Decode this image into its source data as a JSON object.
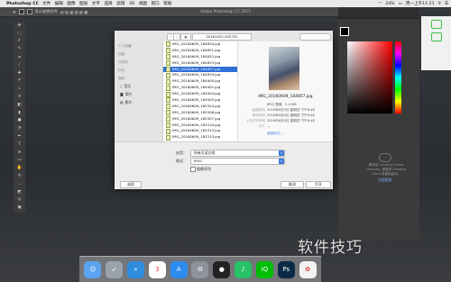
{
  "menubar": {
    "app_name": "Photoshop CC",
    "items": [
      "文件",
      "编辑",
      "图像",
      "图层",
      "文字",
      "选择",
      "滤镜",
      "3D",
      "视图",
      "窗口",
      "帮助"
    ],
    "battery": "24%",
    "clock": "周一上午11:21"
  },
  "options_bar": {
    "checkbox_label": "显示变换控件",
    "window_title": "Adobe Photoshop CC 2015"
  },
  "dialog": {
    "folder": "20161003-005702",
    "sidebar": {
      "sections": [
        {
          "header": "个人收藏",
          "items": []
        },
        {
          "header": "设备",
          "items": []
        },
        {
          "header": "共享的",
          "items": []
        },
        {
          "header": "标记",
          "items": []
        },
        {
          "header": "媒体",
          "items": [
            {
              "label": "音乐",
              "icon": "music-note-icon"
            },
            {
              "label": "照片",
              "icon": "camera-icon"
            },
            {
              "label": "影片",
              "icon": "film-icon"
            }
          ]
        }
      ]
    },
    "files": [
      {
        "name": "IMG_20160609_184850.jpg",
        "selected": false
      },
      {
        "name": "IMG_20160609_184851.jpg",
        "selected": false
      },
      {
        "name": "IMG_20160609_184852.jpg",
        "selected": false
      },
      {
        "name": "IMG_20160609_184853.jpg",
        "selected": false
      },
      {
        "name": "IMG_20160609_184857.jpg",
        "selected": true
      },
      {
        "name": "IMG_20160609_184859.jpg",
        "selected": false
      },
      {
        "name": "IMG_20160609_184900.jpg",
        "selected": false
      },
      {
        "name": "IMG_20160609_184901.jpg",
        "selected": false
      },
      {
        "name": "IMG_20160609_184904.jpg",
        "selected": false
      },
      {
        "name": "IMG_20160609_184905.jpg",
        "selected": false
      },
      {
        "name": "IMG_20160609_185304.jpg",
        "selected": false
      },
      {
        "name": "IMG_20160609_185306.jpg",
        "selected": false
      },
      {
        "name": "IMG_20160609_185307.jpg",
        "selected": false
      },
      {
        "name": "IMG_20160609_185310.jpg",
        "selected": false
      },
      {
        "name": "IMG_20160609_185313.jpg",
        "selected": false
      },
      {
        "name": "IMG_20160609_185315.jpg",
        "selected": false
      },
      {
        "name": "IMG_20160609_185410.jpg",
        "selected": false
      }
    ],
    "preview": {
      "filename": "IMG_20160609_184857.jpg",
      "meta": [
        {
          "k": "",
          "v": "JPEG 图像 - 2.4 MB"
        },
        {
          "k": "创建时间",
          "v": "2016年6月9日 星期四 下午6:48"
        },
        {
          "k": "修改时间",
          "v": "2016年6月9日 星期四 下午6:48"
        },
        {
          "k": "上次打开时间",
          "v": "2016年6月9日 星期四 下午6:48"
        },
        {
          "k": "尺寸",
          "v": "—"
        }
      ],
      "more_link": "添加标记..."
    },
    "enable_label": "启用：",
    "enable_value": "所有可读文档",
    "format_label": "格式：",
    "format_value": "JPEG",
    "sequence_label": "图像序列",
    "options_button": "选项",
    "cancel_button": "取消",
    "open_button": "打开"
  },
  "panels": {
    "cc_text": "要使用 Creative Cloud Libraries, 请登录 Creative Cloud 或重新启动。",
    "cc_link": "立即登录"
  },
  "dock_apps": [
    {
      "name": "finder",
      "icon": "finder-icon",
      "color": "#5ba3f0",
      "glyph": "☺"
    },
    {
      "name": "launchpad",
      "icon": "rocket-icon",
      "color": "#9aa3ad",
      "glyph": "➶"
    },
    {
      "name": "safari",
      "icon": "safari-compass-icon",
      "color": "#2f8de0",
      "glyph": "⌖"
    },
    {
      "name": "calendar",
      "icon": "calendar-icon",
      "color": "#ffffff",
      "glyph": "3"
    },
    {
      "name": "app-store",
      "icon": "app-store-icon",
      "color": "#2d8cf0",
      "glyph": "A"
    },
    {
      "name": "system-preferences",
      "icon": "gear-icon",
      "color": "#8d939b",
      "glyph": "⚙"
    },
    {
      "name": "qq",
      "icon": "penguin-icon",
      "color": "#222222",
      "glyph": "●"
    },
    {
      "name": "qq-music",
      "icon": "music-note-icon",
      "color": "#27c267",
      "glyph": "♪"
    },
    {
      "name": "iqiyi",
      "icon": "iqiyi-icon",
      "color": "#00be06",
      "glyph": "iQ"
    },
    {
      "name": "photoshop",
      "icon": "photoshop-icon",
      "color": "#0b2a45",
      "glyph": "Ps"
    },
    {
      "name": "photos",
      "icon": "photos-pinwheel-icon",
      "color": "#f3f3f3",
      "glyph": "✿"
    }
  ],
  "watermark": "软件技巧"
}
